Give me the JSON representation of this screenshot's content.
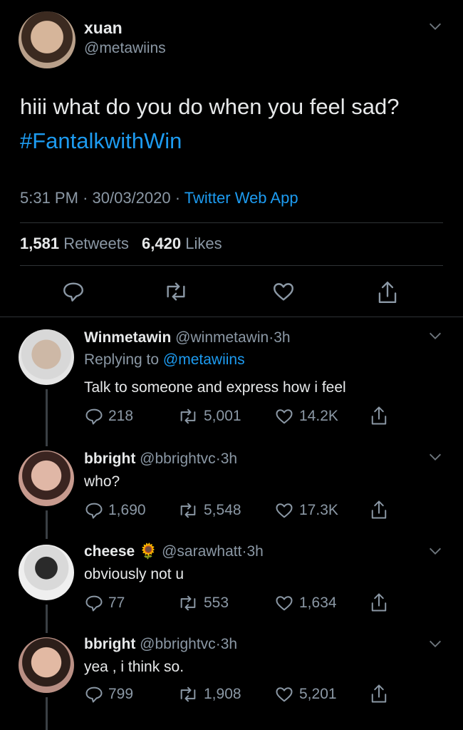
{
  "main_tweet": {
    "display_name": "xuan",
    "handle": "@metawiins",
    "text": "hiii what do you do when you feel sad?",
    "hashtag": "#FantalkwithWin",
    "time": "5:31 PM",
    "date": "30/03/2020",
    "client": "Twitter Web App",
    "retweets_count": "1,581",
    "retweets_label": "Retweets",
    "likes_count": "6,420",
    "likes_label": "Likes"
  },
  "replies": [
    {
      "display_name": "Winmetawin",
      "handle": "@winmetawin",
      "age": "3h",
      "replying_label": "Replying to",
      "replying_to": "@metawiins",
      "text": "Talk to someone and express how i feel",
      "replies": "218",
      "retweets": "5,001",
      "likes": "14.2K"
    },
    {
      "display_name": "bbright",
      "handle": "@bbrightvc",
      "age": "3h",
      "text": "who?",
      "replies": "1,690",
      "retweets": "5,548",
      "likes": "17.3K"
    },
    {
      "display_name": "cheese",
      "emoji": "🌻",
      "handle": "@sarawhatt",
      "age": "3h",
      "text": "obviously not u",
      "replies": "77",
      "retweets": "553",
      "likes": "1,634"
    },
    {
      "display_name": "bbright",
      "handle": "@bbrightvc",
      "age": "3h",
      "text": "yea , i think so.",
      "replies": "799",
      "retweets": "1,908",
      "likes": "5,201"
    }
  ],
  "separator": "·",
  "colors": {
    "background": "#000000",
    "text": "#d9d9d9",
    "muted": "#8b98a5",
    "link": "#1d9bf0"
  }
}
